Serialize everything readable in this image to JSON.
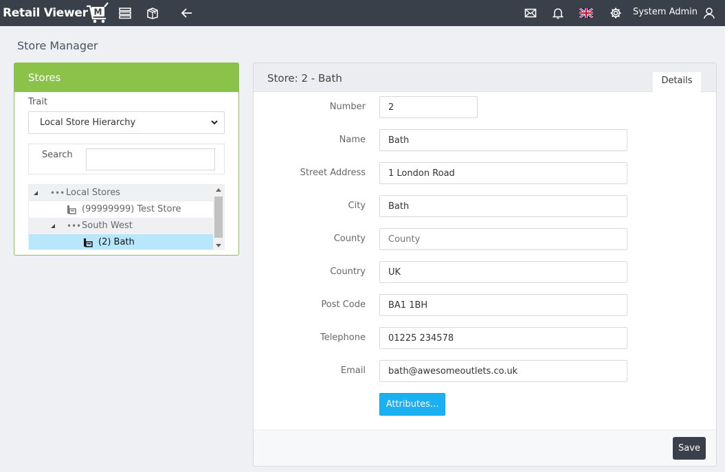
{
  "app": {
    "logo_text": "Retail Viewer",
    "logo_badge": "M"
  },
  "topbar": {
    "icons": [
      "menu-list-icon",
      "box-icon",
      "back-arrow-icon",
      "mail-icon",
      "bell-icon",
      "uk-flag-icon",
      "gear-icon",
      "user-icon"
    ],
    "user_name": "System Admin"
  },
  "page": {
    "title": "Store Manager"
  },
  "stores_panel": {
    "header": "Stores",
    "trait_label": "Trait",
    "trait_selected": "Local Store Hierarchy",
    "search_label": "Search",
    "search_value": "",
    "tree": [
      {
        "label": "Local Stores",
        "type": "group",
        "level": 0,
        "expanded": true,
        "selected": false
      },
      {
        "label": "(99999999) Test Store",
        "type": "store",
        "level": 1,
        "selected": false
      },
      {
        "label": "South West",
        "type": "group",
        "level": 1,
        "expanded": true,
        "selected": false
      },
      {
        "label": "(2) Bath",
        "type": "store",
        "level": 2,
        "selected": true
      }
    ]
  },
  "detail_panel": {
    "title": "Store: 2 - Bath",
    "tab_label": "Details",
    "fields": [
      {
        "label": "Number",
        "value": "2",
        "placeholder": ""
      },
      {
        "label": "Name",
        "value": "Bath",
        "placeholder": ""
      },
      {
        "label": "Street Address",
        "value": "1 London Road",
        "placeholder": ""
      },
      {
        "label": "City",
        "value": "Bath",
        "placeholder": ""
      },
      {
        "label": "County",
        "value": "",
        "placeholder": "County"
      },
      {
        "label": "Country",
        "value": "UK",
        "placeholder": ""
      },
      {
        "label": "Post Code",
        "value": "BA1 1BH",
        "placeholder": ""
      },
      {
        "label": "Telephone",
        "value": "01225 234578",
        "placeholder": ""
      },
      {
        "label": "Email",
        "value": "bath@awesomeoutlets.co.uk",
        "placeholder": ""
      }
    ],
    "attributes_label": "Attributes...",
    "save_label": "Save"
  },
  "colors": {
    "topbar": "#3a4049",
    "stores_accent": "#8bc34a",
    "primary_button": "#1ab0f2",
    "selected_row": "#b8e6fb"
  }
}
